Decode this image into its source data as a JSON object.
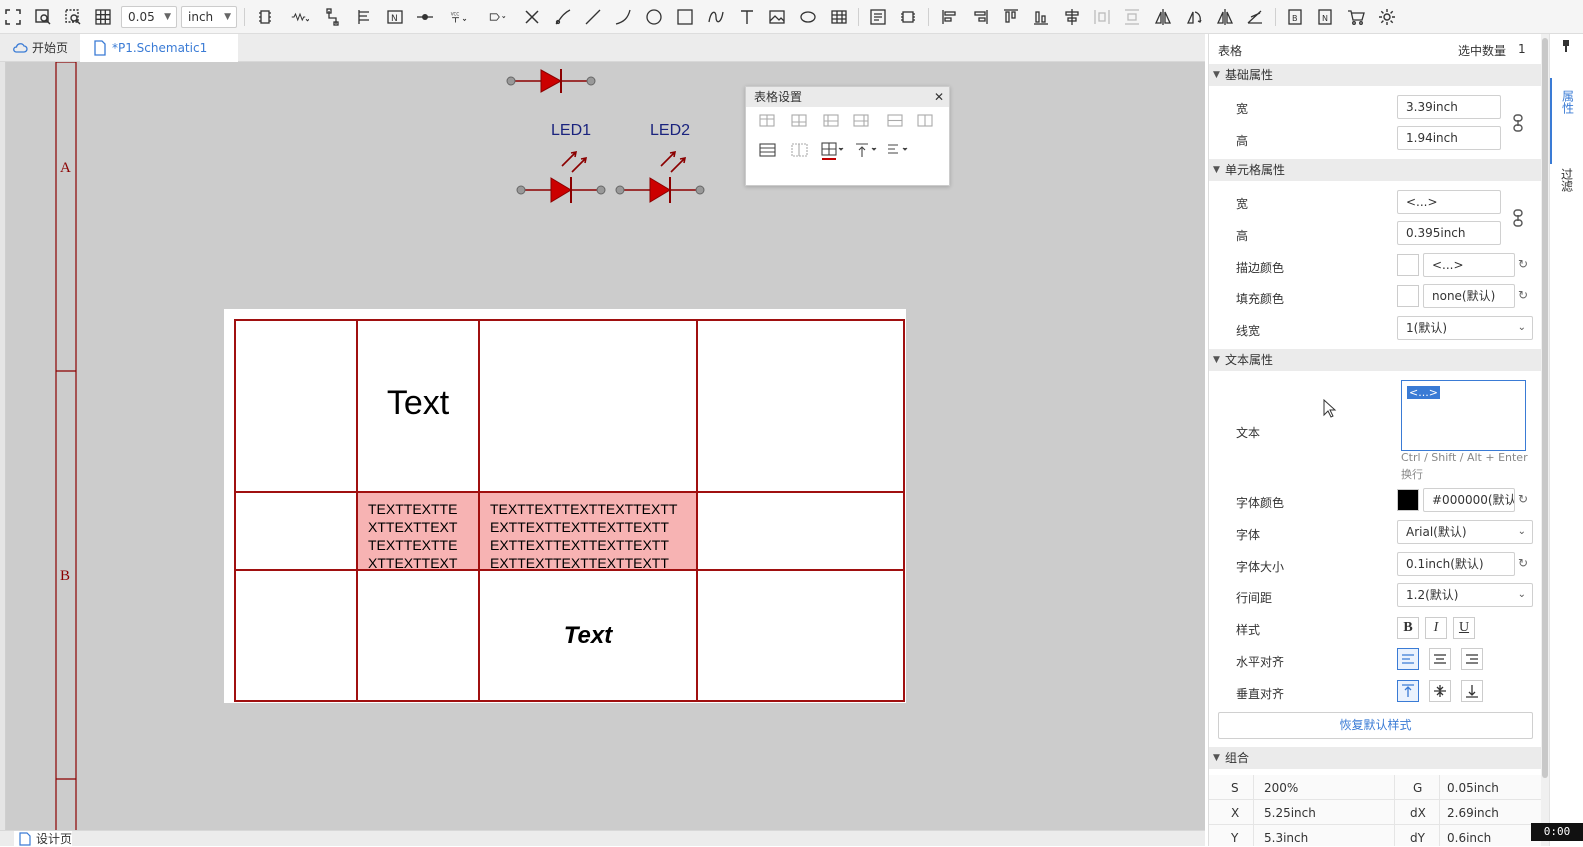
{
  "toolbar": {
    "grid_value": "0.05",
    "unit": "inch",
    "vcc_label": "VCC"
  },
  "tabs": [
    {
      "label": "开始页"
    },
    {
      "label": "*P1.Schematic1"
    }
  ],
  "canvas": {
    "frame_labels": [
      "A",
      "B"
    ],
    "leds": [
      {
        "label": "LED1"
      },
      {
        "label": "LED2"
      }
    ],
    "table": {
      "cell_text_large": "Text",
      "cell_text_narrow": "TEXTTEXTTEXTTEXTTEXTTEXTTEXTTEXT",
      "cell_text_narrow_lines": [
        "TEXTTEXTTE",
        "XTTEXTTEXT",
        "TEXTTEXTTE",
        "XTTEXTTEXT"
      ],
      "cell_text_wide_lines": [
        "TEXTTEXTTEXTTEXTTEXTT",
        "EXTTEXTTEXTTEXTTEXTT",
        "EXTTEXTTEXTTEXTTEXTT",
        "EXTTEXTTEXTTEXTTEXTT"
      ],
      "cell_text_italic": "Text"
    },
    "table_settings": {
      "title": "表格设置",
      "close": "✕"
    }
  },
  "bottom_tab": "设计页",
  "panel": {
    "title": "表格",
    "selected_label": "选中数量",
    "selected_count": "1",
    "sections": {
      "basic": "基础属性",
      "cell": "单元格属性",
      "text": "文本属性",
      "group": "组合"
    },
    "basic": {
      "width_label": "宽",
      "width_value": "3.39inch",
      "height_label": "高",
      "height_value": "1.94inch"
    },
    "cell": {
      "width_label": "宽",
      "width_value": "<...>",
      "height_label": "高",
      "height_value": "0.395inch",
      "stroke_label": "描边颜色",
      "stroke_value": "<...>",
      "fill_label": "填充颜色",
      "fill_value": "none(默认)",
      "linewidth_label": "线宽",
      "linewidth_value": "1(默认)"
    },
    "text": {
      "text_label": "文本",
      "text_value": "<...>",
      "hint": "Ctrl / Shift / Alt + Enter",
      "hint2": "换行",
      "font_color_label": "字体颜色",
      "font_color_value": "#000000(默认)",
      "font_label": "字体",
      "font_value": "Arial(默认)",
      "font_size_label": "字体大小",
      "font_size_value": "0.1inch(默认)",
      "line_spacing_label": "行间距",
      "line_spacing_value": "1.2(默认)",
      "style_label": "样式",
      "bold": "B",
      "italic": "I",
      "underline": "U",
      "halign_label": "水平对齐",
      "valign_label": "垂直对齐",
      "reset_button": "恢复默认样式"
    },
    "group": {
      "s_label": "S",
      "s_value": "200%",
      "g_label": "G",
      "g_value": "0.05inch",
      "x_label": "X",
      "x_value": "5.25inch",
      "dx_label": "dX",
      "dx_value": "2.69inch",
      "y_label": "Y",
      "y_value": "5.3inch",
      "dy_label": "dY",
      "dy_value": "0.6inch"
    }
  },
  "side_tabs": [
    {
      "label": "属性"
    },
    {
      "label": "过滤"
    }
  ],
  "timer": "0:00",
  "colors": {
    "accent": "#3a7bd5",
    "wire": "#8b0000",
    "led": "#cc0000",
    "highlight": "#f7b3b3",
    "canvas": "#cccccc"
  }
}
